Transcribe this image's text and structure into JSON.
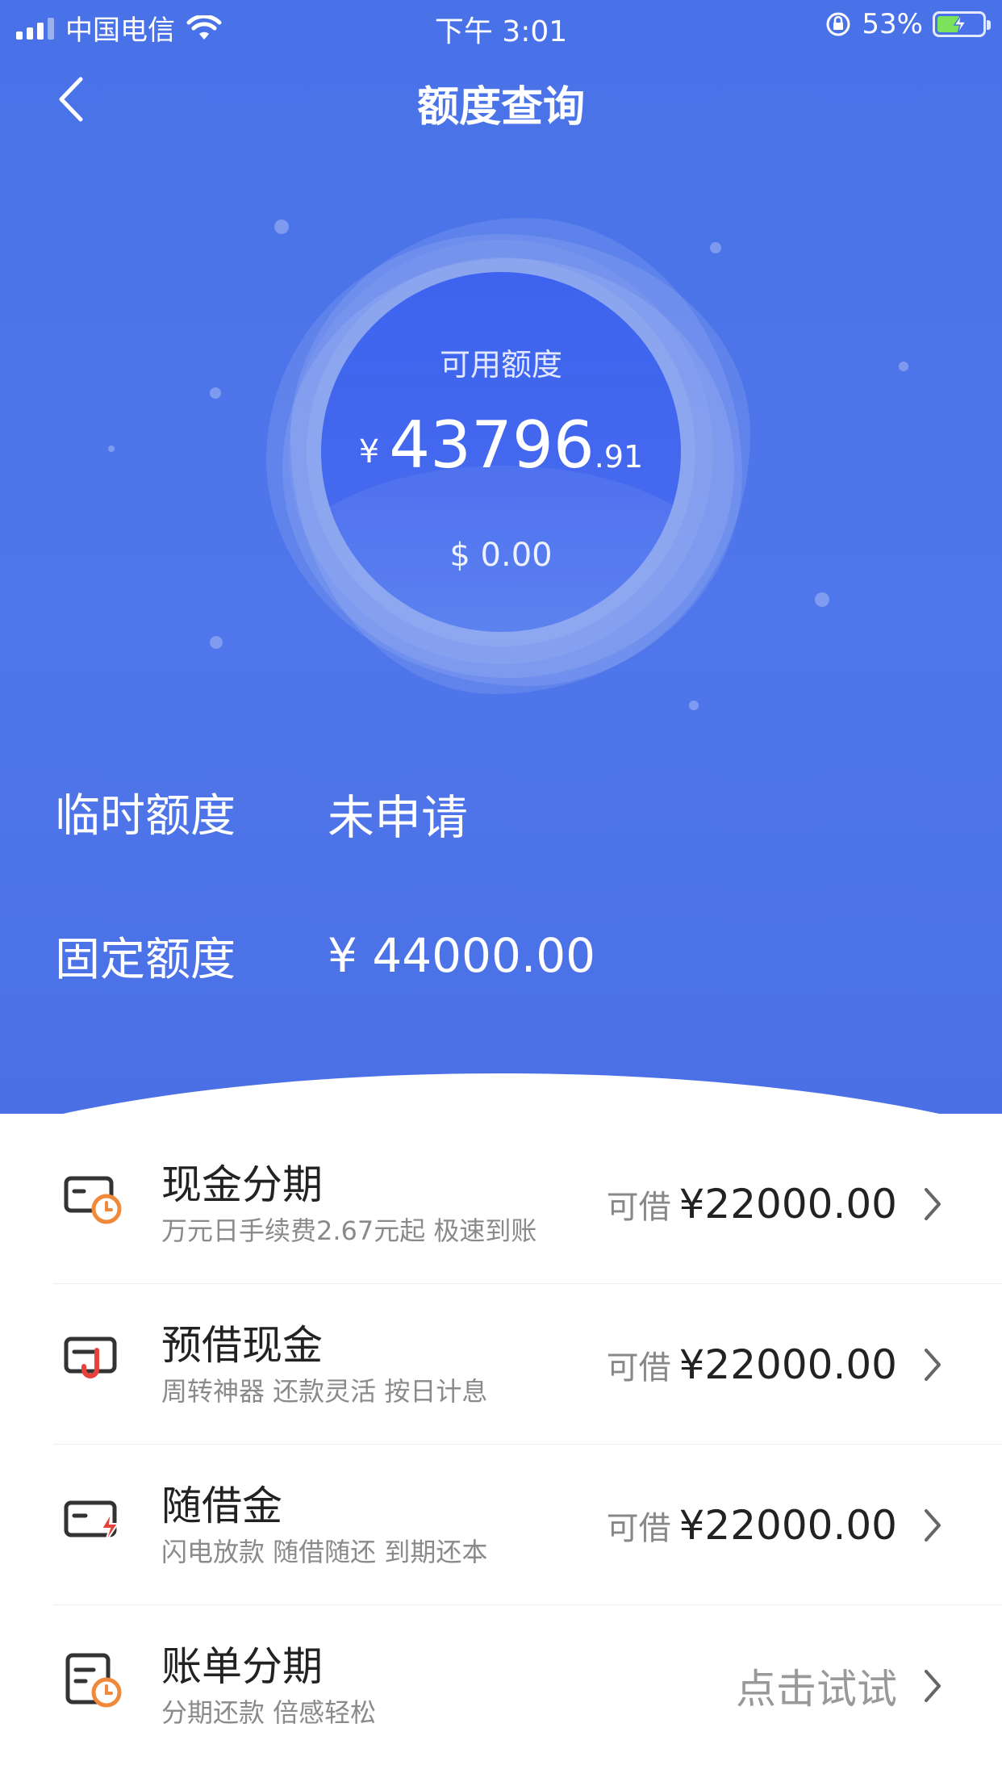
{
  "status_bar": {
    "carrier": "中国电信",
    "time": "下午 3:01",
    "battery": "53%",
    "icons": [
      "signal-icon",
      "wifi-icon",
      "orientation-lock-icon",
      "battery-charging-icon"
    ]
  },
  "nav": {
    "title": "额度查询",
    "back_icon": "chevron-left-icon"
  },
  "balance": {
    "label": "可用额度",
    "currency": "¥",
    "integer": "43796",
    "decimal": ".91",
    "usd": "$ 0.00"
  },
  "quotas": [
    {
      "label": "临时额度",
      "value": "未申请"
    },
    {
      "label": "固定额度",
      "value": "¥ 44000.00"
    }
  ],
  "products": [
    {
      "title": "现金分期",
      "subtitle": "万元日手续费2.67元起 极速到账",
      "right_label": "可借",
      "right_value": "¥22000.00",
      "icon": "card-clock-icon"
    },
    {
      "title": "预借现金",
      "subtitle": "周转神器 还款灵活 按日计息",
      "right_label": "可借",
      "right_value": "¥22000.00",
      "icon": "card-hook-icon"
    },
    {
      "title": "随借金",
      "subtitle": "闪电放款 随借随还 到期还本",
      "right_label": "可借",
      "right_value": "¥22000.00",
      "icon": "card-lightning-icon"
    },
    {
      "title": "账单分期",
      "subtitle": "分期还款 倍感轻松",
      "right_text": "点击试试",
      "icon": "bill-clock-icon"
    }
  ],
  "colors": {
    "hero_blue": "#4a72e8",
    "accent_orange": "#f08a3a",
    "accent_red": "#e8403a"
  }
}
